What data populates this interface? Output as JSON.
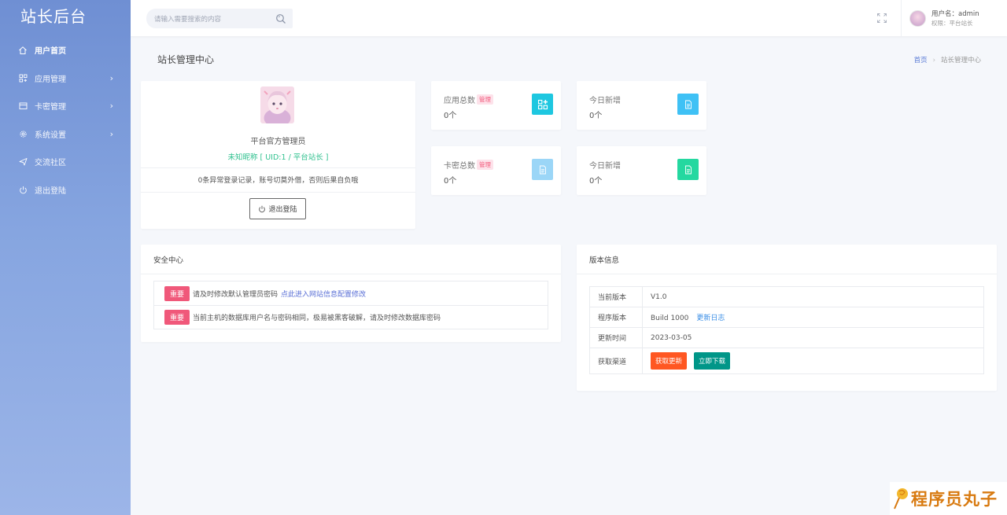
{
  "sidebar": {
    "brand": "站长后台",
    "items": [
      {
        "label": "用户首页",
        "icon": "home-icon",
        "active": true
      },
      {
        "label": "应用管理",
        "icon": "apps-icon",
        "has_arrow": true
      },
      {
        "label": "卡密管理",
        "icon": "card-icon",
        "has_arrow": true
      },
      {
        "label": "系统设置",
        "icon": "gear-icon",
        "has_arrow": true
      },
      {
        "label": "交流社区",
        "icon": "send-icon"
      },
      {
        "label": "退出登陆",
        "icon": "power-icon"
      }
    ]
  },
  "topbar": {
    "search_placeholder": "请输入需要搜索的内容",
    "user_name": "用户名：admin",
    "user_role": "权限：平台站长"
  },
  "page": {
    "title": "站长管理中心",
    "breadcrumb_home": "首页",
    "breadcrumb_current": "站长管理中心"
  },
  "profile": {
    "name": "平台官方管理员",
    "nickname": "未知昵称 [ UID:1 / 平台站长 ]",
    "warning": "0条异常登录记录，账号切莫外借，否则后果自负哦",
    "logout_label": "退出登陆"
  },
  "stats": [
    {
      "title": "应用总数",
      "badge": "管理",
      "value": "0个",
      "icon": "apps-add-icon",
      "color": "#1ec7e0"
    },
    {
      "title": "今日新增",
      "value": "0个",
      "icon": "document-icon",
      "color": "#3fc1f5"
    },
    {
      "title": "卡密总数",
      "badge": "管理",
      "value": "0个",
      "icon": "document-icon",
      "color": "#9bd6f7"
    },
    {
      "title": "今日新增",
      "value": "0个",
      "icon": "document-icon",
      "color": "#24d8a0"
    }
  ],
  "security": {
    "title": "安全中心",
    "rows": [
      {
        "tag": "重要",
        "text": "请及时修改默认管理员密码",
        "link": "点此进入网站信息配置修改"
      },
      {
        "tag": "重要",
        "text": "当前主机的数据库用户名与密码相同，极易被黑客破解，请及时修改数据库密码"
      }
    ]
  },
  "version": {
    "title": "版本信息",
    "current_label": "当前版本",
    "current_value": "V1.0",
    "program_label": "程序版本",
    "program_value": "Build 1000",
    "changelog_link": "更新日志",
    "updated_label": "更新时间",
    "updated_value": "2023-03-05",
    "channel_label": "获取渠道",
    "get_update": "获取更新",
    "download_now": "立即下载"
  },
  "watermark": "程序员丸子",
  "colors": {
    "sidebar_top": "#6f8fd3",
    "sidebar_bottom": "#9cb5e8",
    "accent_green": "#30c18f",
    "danger": "#f0587a",
    "orange": "#ff5722",
    "teal": "#009688"
  }
}
